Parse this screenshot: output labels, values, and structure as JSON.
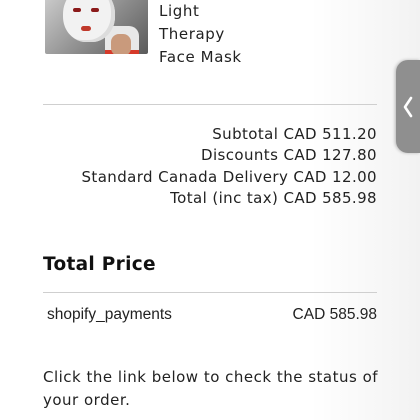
{
  "product": {
    "name_lines": [
      "Light",
      "Therapy",
      "Face Mask"
    ],
    "image_icon": "product-photo-face-mask"
  },
  "summary": {
    "subtotal": "Subtotal CAD 511.20",
    "discounts": "Discounts CAD 127.80",
    "delivery": "Standard Canada Delivery CAD 12.00",
    "total": "Total (inc tax) CAD 585.98"
  },
  "total_price": {
    "heading": "Total Price",
    "payment_method": "shopify_payments",
    "amount": "CAD 585.98"
  },
  "note": {
    "text": "Click the link below to check the status of your order."
  },
  "side_tab": {
    "icon": "chevron-left-icon",
    "color": "#8f8f8f"
  }
}
